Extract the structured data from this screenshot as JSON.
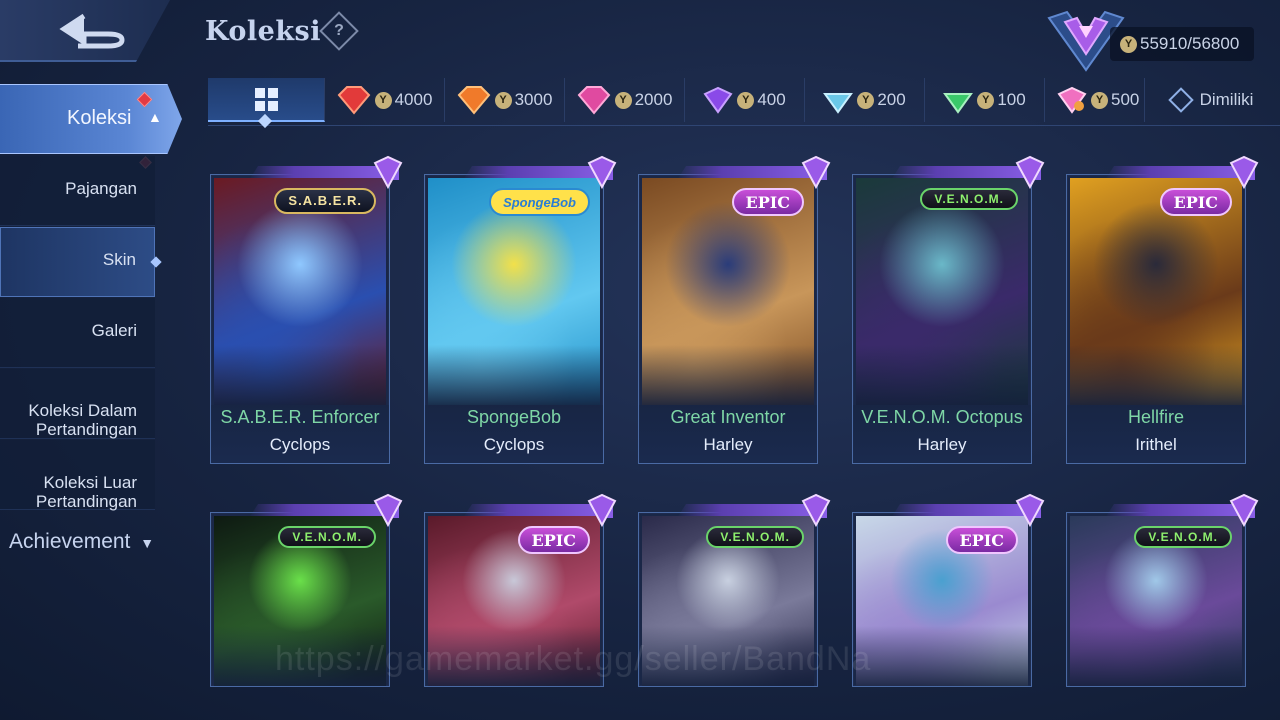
{
  "header": {
    "title": "Koleksi",
    "help_glyph": "?",
    "points_value": "55910/56800"
  },
  "sidebar": {
    "main_label": "Koleksi",
    "items": [
      {
        "label": "Pajangan",
        "active": false
      },
      {
        "label": "Skin",
        "active": true
      },
      {
        "label": "Galeri",
        "active": false
      },
      {
        "label": "Koleksi Dalam\nPertandingan",
        "active": false
      },
      {
        "label": "Koleksi Luar\nPertandingan",
        "active": false
      }
    ],
    "achievement_label": "Achievement"
  },
  "tabs": [
    {
      "kind": "all",
      "icon": "grid-icon",
      "label": ""
    },
    {
      "kind": "tier",
      "icon": "red-gem-icon",
      "value": "4000",
      "color": "#e23a3a"
    },
    {
      "kind": "tier",
      "icon": "orange-gem-icon",
      "value": "3000",
      "color": "#f07a2a"
    },
    {
      "kind": "tier",
      "icon": "pink-gem-icon",
      "value": "2000",
      "color": "#e04aa0"
    },
    {
      "kind": "tier",
      "icon": "purple-gem-icon",
      "value": "400",
      "color": "#8a4ae8"
    },
    {
      "kind": "tier",
      "icon": "cyan-gem-icon",
      "value": "200",
      "color": "#6ac8e8"
    },
    {
      "kind": "tier",
      "icon": "green-gem-icon",
      "value": "100",
      "color": "#3ac86a"
    },
    {
      "kind": "tier",
      "icon": "rainbow-gem-icon",
      "value": "500",
      "color": "#f070c0"
    },
    {
      "kind": "owned",
      "icon": "owned-diamond-icon",
      "label": "Dimiliki"
    }
  ],
  "cards": [
    {
      "skin": "S.A.B.E.R. Enforcer",
      "hero": "Cyclops",
      "badge": "S.A.B.E.R.",
      "badge_type": "saber",
      "art": [
        "#6b1a22",
        "#2a4fb0",
        "#8fc8ff"
      ]
    },
    {
      "skin": "SpongeBob",
      "hero": "Cyclops",
      "badge": "SpongeBob",
      "badge_type": "sponge",
      "art": [
        "#1f8fc8",
        "#62c8f0",
        "#f2e04a"
      ]
    },
    {
      "skin": "Great Inventor",
      "hero": "Harley",
      "badge": "EPIC",
      "badge_type": "epic",
      "art": [
        "#7a4a22",
        "#c8965a",
        "#2a3c7a"
      ]
    },
    {
      "skin": "V.E.N.O.M. Octopus",
      "hero": "Harley",
      "badge": "V.E.N.O.M.",
      "badge_type": "venom",
      "art": [
        "#1a3a3a",
        "#3a2a6a",
        "#6ab8c8"
      ]
    },
    {
      "skin": "Hellfire",
      "hero": "Irithel",
      "badge": "EPIC",
      "badge_type": "epic",
      "art": [
        "#e0a020",
        "#6a3a1a",
        "#2a2a3a"
      ]
    },
    {
      "skin": "",
      "hero": "",
      "badge": "V.E.N.O.M.",
      "badge_type": "venom",
      "art": [
        "#0e1a12",
        "#2a5a2a",
        "#6ae04a"
      ]
    },
    {
      "skin": "",
      "hero": "",
      "badge": "EPIC",
      "badge_type": "epic",
      "art": [
        "#5a1a2a",
        "#b04a6a",
        "#c8c8d8"
      ]
    },
    {
      "skin": "",
      "hero": "",
      "badge": "V.E.N.O.M.",
      "badge_type": "venom",
      "art": [
        "#2a2a4a",
        "#7a7a9a",
        "#c8d0e0"
      ]
    },
    {
      "skin": "",
      "hero": "",
      "badge": "EPIC",
      "badge_type": "epic",
      "art": [
        "#c8d8e8",
        "#9a8ad0",
        "#4aa0d0"
      ]
    },
    {
      "skin": "",
      "hero": "",
      "badge": "V.E.N.O.M.",
      "badge_type": "venom",
      "art": [
        "#2a3a5a",
        "#6a4a9a",
        "#a0c8e8"
      ]
    }
  ],
  "watermark": "https://gamemarket.gg/seller/BandNa"
}
